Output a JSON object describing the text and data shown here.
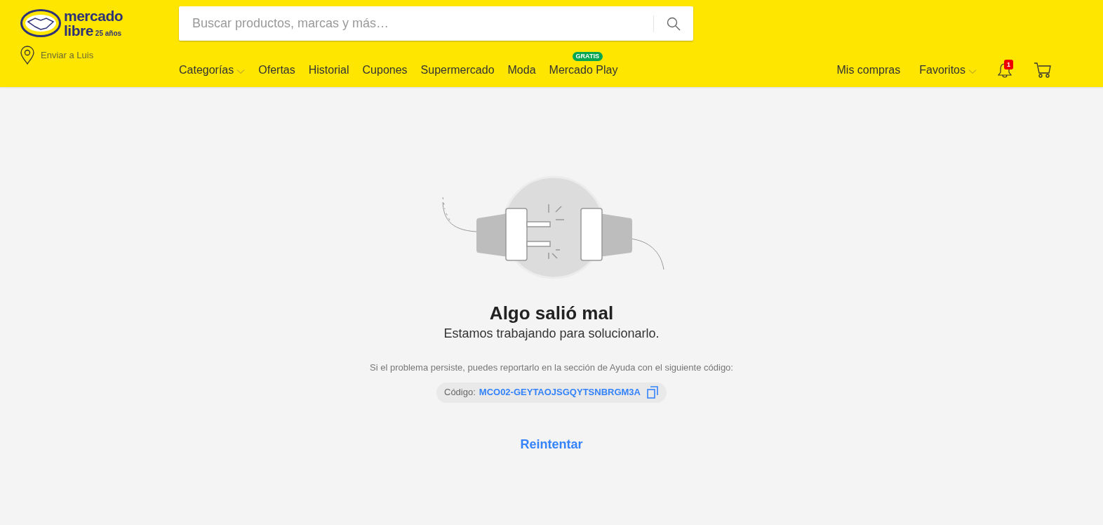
{
  "header": {
    "logo": {
      "line1": "mercado",
      "line2": "libre",
      "anniversary": "25 años"
    },
    "location": "Enviar a Luis",
    "search": {
      "placeholder": "Buscar productos, marcas y más…"
    },
    "nav": [
      {
        "label": "Categorías",
        "has_dropdown": true
      },
      {
        "label": "Ofertas",
        "has_dropdown": false
      },
      {
        "label": "Historial",
        "has_dropdown": false
      },
      {
        "label": "Cupones",
        "has_dropdown": false
      },
      {
        "label": "Supermercado",
        "has_dropdown": false
      },
      {
        "label": "Moda",
        "has_dropdown": false
      },
      {
        "label": "Mercado Play",
        "has_dropdown": false,
        "badge": "GRATIS"
      }
    ],
    "account_nav": [
      {
        "label": "Mis compras",
        "has_dropdown": false
      },
      {
        "label": "Favoritos",
        "has_dropdown": true
      }
    ],
    "notifications_count": "1"
  },
  "error": {
    "title": "Algo salió mal",
    "subtitle": "Estamos trabajando para solucionarlo.",
    "help_text": "Si el problema persiste, puedes reportarlo en la sección de Ayuda con el siguiente código:",
    "code_label": "Código:",
    "code": "MCO02-GEYTAOJSGQYTSNBRGM3A",
    "retry": "Reintentar"
  }
}
